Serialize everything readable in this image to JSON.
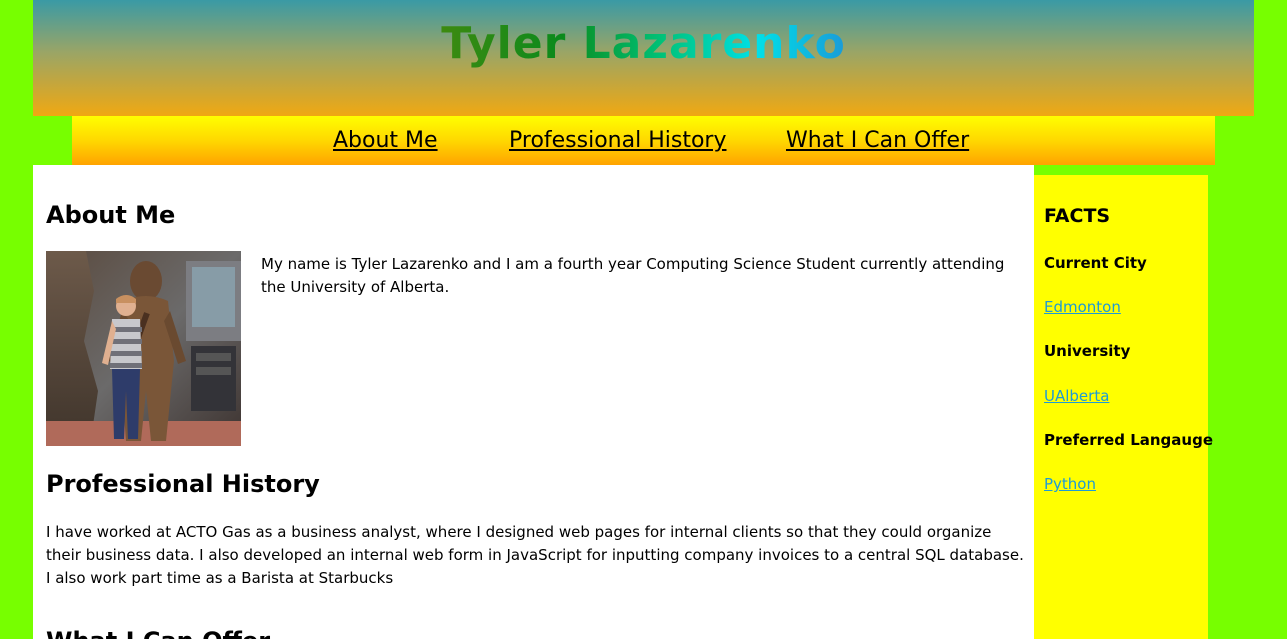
{
  "header": {
    "title": "Tyler Lazarenko"
  },
  "nav": {
    "items": [
      {
        "label": "About Me"
      },
      {
        "label": "Professional History"
      },
      {
        "label": "What I Can Offer"
      }
    ]
  },
  "main": {
    "about": {
      "heading": "About Me",
      "text": "My name is Tyler Lazarenko and I am a fourth year Computing Science Student currently attending the University of Alberta."
    },
    "professional": {
      "heading": "Professional History",
      "text": "I have worked at ACTO Gas as a business analyst, where I designed web pages for internal clients so that they could organize their business data. I also developed an internal web form in JavaScript for inputting company invoices to a central SQL database. I also work part time as a Barista at Starbucks"
    },
    "offer": {
      "heading": "What I Can Offer"
    }
  },
  "sidebar": {
    "title": "FACTS",
    "facts": [
      {
        "label": "Current City",
        "value": "Edmonton"
      },
      {
        "label": "University",
        "value": "UAlberta"
      },
      {
        "label": "Preferred Langauge",
        "value": "Python"
      }
    ]
  },
  "colors": {
    "page_background": "#77ff00",
    "sidebar_background": "#ffff00",
    "link_color": "#1e9bd6"
  }
}
